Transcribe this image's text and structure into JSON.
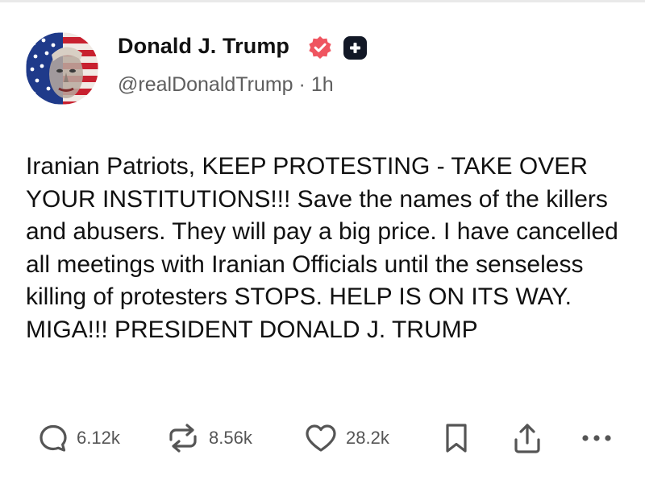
{
  "author": {
    "display_name": "Donald J. Trump",
    "handle": "@realDonaldTrump",
    "separator": "·",
    "timestamp": "1h",
    "avatar_icon": "flag-portrait-avatar-icon",
    "verified_icon": "verified-badge-icon",
    "plus_icon": "plus-badge-icon"
  },
  "post": {
    "text": "Iranian Patriots, KEEP PROTESTING - TAKE OVER YOUR INSTITUTIONS!!! Save the names of the killers and abusers. They will pay a big price. I have cancelled all meetings with Iranian Officials until the senseless killing of protesters STOPS. HELP IS ON ITS WAY. MIGA!!! PRESIDENT DONALD J. TRUMP"
  },
  "actions": {
    "replies": {
      "icon": "reply-icon",
      "count": "6.12k"
    },
    "reposts": {
      "icon": "repost-icon",
      "count": "8.56k"
    },
    "likes": {
      "icon": "heart-icon",
      "count": "28.2k"
    },
    "bookmark": {
      "icon": "bookmark-icon"
    },
    "share": {
      "icon": "share-icon"
    },
    "more": {
      "icon": "more-icon"
    }
  },
  "colors": {
    "verified_badge": "#ef5560",
    "plus_badge": "#121826",
    "secondary_text": "#5e5e5e",
    "action_icons": "#555555",
    "flag_red": "#c8202f",
    "flag_blue": "#1f3a8a"
  }
}
